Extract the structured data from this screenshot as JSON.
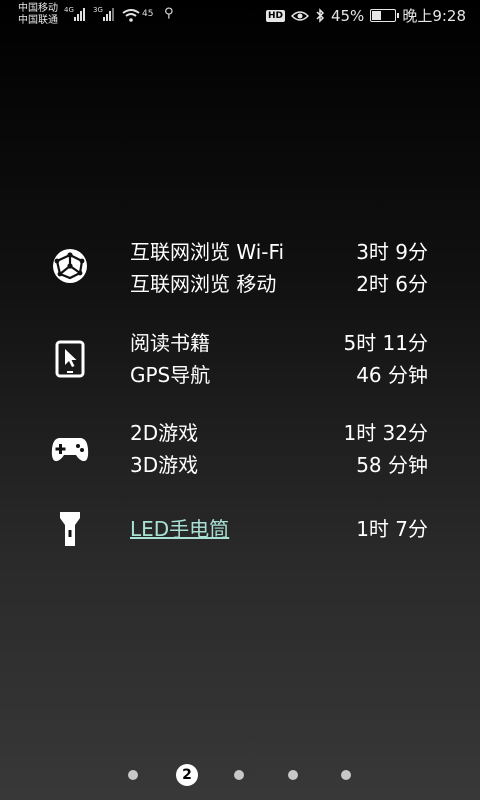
{
  "status_bar": {
    "carrier1": "中国移动",
    "carrier2": "中国联通",
    "net1": "4G",
    "net2": "3G",
    "wifi_battery_small": "45",
    "battery_percent": "45%",
    "battery_level": 0.45,
    "time": "晚上9:28",
    "hd_badge": "HD"
  },
  "groups": [
    {
      "icon": "globe-icon",
      "items": [
        {
          "name": "互联网浏览 Wi-Fi",
          "time": "3时 9分"
        },
        {
          "name": "互联网浏览 移动",
          "time": "2时 6分"
        }
      ]
    },
    {
      "icon": "tablet-cursor-icon",
      "items": [
        {
          "name": "阅读书籍",
          "time": "5时 11分"
        },
        {
          "name": "GPS导航",
          "time": "46 分钟"
        }
      ]
    },
    {
      "icon": "gamepad-icon",
      "items": [
        {
          "name": "2D游戏",
          "time": "1时 32分"
        },
        {
          "name": "3D游戏",
          "time": "58 分钟"
        }
      ]
    },
    {
      "icon": "flashlight-icon",
      "items": [
        {
          "name": "LED手电筒",
          "time": "1时 7分"
        }
      ]
    }
  ],
  "pager": {
    "current_page": "2",
    "total_pages": 5
  }
}
